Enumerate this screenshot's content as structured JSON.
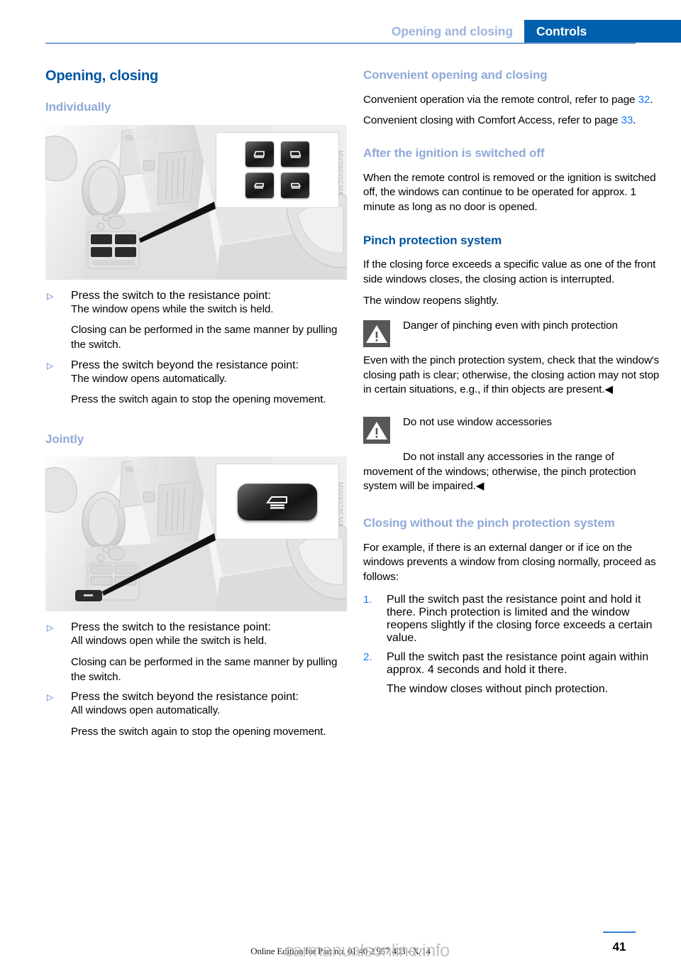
{
  "header": {
    "section": "Opening and closing",
    "chapter": "Controls"
  },
  "left_column": {
    "title": "Opening, closing",
    "individually_heading": "Individually",
    "figure1_code": "MV09035CMA",
    "individually_steps": [
      {
        "bullet": "Press the switch to the resistance point:",
        "lines": [
          "The window opens while the switch is held.",
          "Closing can be performed in the same manner by pulling the switch."
        ]
      },
      {
        "bullet": "Press the switch beyond the resistance point:",
        "lines": [
          "The window opens automatically.",
          "Press the switch again to stop the opening movement."
        ]
      }
    ],
    "jointly_heading": "Jointly",
    "figure2_code": "MV09028CMA",
    "jointly_steps": [
      {
        "bullet": "Press the switch to the resistance point:",
        "lines": [
          "All windows open while the switch is held.",
          "Closing can be performed in the same manner by pulling the switch."
        ]
      },
      {
        "bullet": "Press the switch beyond the resistance point:",
        "lines": [
          "All windows open automatically.",
          "Press the switch again to stop the opening movement."
        ]
      }
    ]
  },
  "right_column": {
    "convenient_heading": "Convenient opening and closing",
    "convenient_p1_a": "Convenient operation via the remote control, refer to page ",
    "convenient_p1_page": "32",
    "convenient_p1_b": ".",
    "convenient_p2_a": "Convenient closing with Comfort Access, refer to page ",
    "convenient_p2_page": "33",
    "convenient_p2_b": ".",
    "ignition_heading": "After the ignition is switched off",
    "ignition_body": "When the remote control is removed or the ignition is switched off, the windows can continue to be operated for approx. 1 minute as long as no door is opened.",
    "pinch_heading": "Pinch protection system",
    "pinch_p1": "If the closing force exceeds a specific value as one of the front side windows closes, the closing action is interrupted.",
    "pinch_p2": "The window reopens slightly.",
    "warning1_title": "Danger of pinching even with pinch protection",
    "warning1_body": "Even with the pinch protection system, check that the window's closing path is clear; otherwise, the closing action may not stop in certain situations, e.g., if thin objects are present.",
    "warning1_endmark": "◀",
    "warning2_title": "Do not use window accessories",
    "warning2_body": "Do not install any accessories in the range of movement of the windows; otherwise, the pinch protection system will be impaired.",
    "warning2_endmark": "◀",
    "closing_heading": "Closing without the pinch protection system",
    "closing_intro": "For example, if there is an external danger or if ice on the windows prevents a window from closing normally, proceed as follows:",
    "closing_steps": [
      {
        "num": "1.",
        "text": "Pull the switch past the resistance point and hold it there. Pinch protection is limited and the window reopens slightly if the closing force exceeds a certain value."
      },
      {
        "num": "2.",
        "text": "Pull the switch past the resistance point again within approx. 4 seconds and hold it there.",
        "sub": "The window closes without pinch protection."
      }
    ]
  },
  "footer": {
    "edition": "Online Edition for Part no. 01 40 2 957 403 - X/14",
    "page_number": "41",
    "watermark": "carmanualsonline.info"
  },
  "icons": {
    "bullet_arrow": "▷",
    "warning": "warning-triangle-icon",
    "window_switch": "window-switch-icon",
    "all_windows_switch": "all-windows-switch-icon"
  },
  "colors": {
    "chapter_tab": "#0060ad",
    "section_text": "#9db4de",
    "heading_dark": "#00549f",
    "heading_light": "#8fa9d7",
    "page_ref_link": "#1479ff",
    "rule": "#7d9fd4"
  }
}
